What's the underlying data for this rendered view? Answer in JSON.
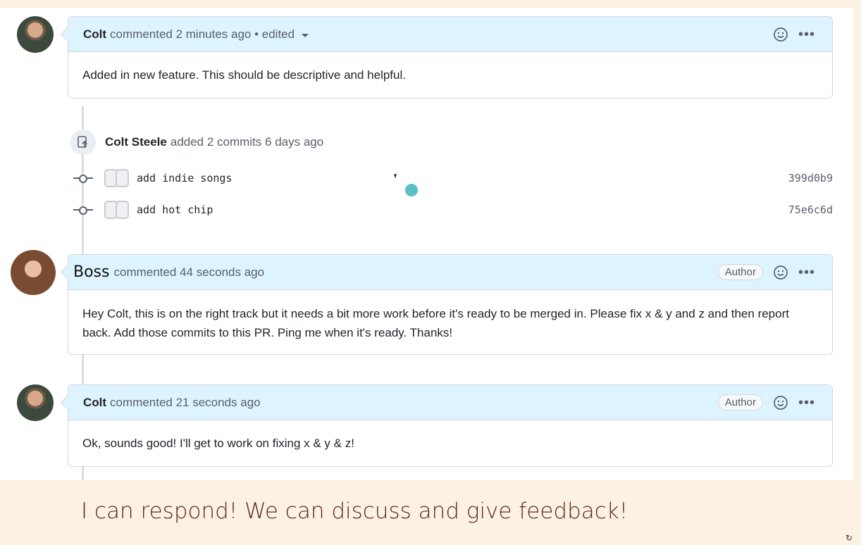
{
  "comments": [
    {
      "author": "Colt",
      "meta": "commented 2 minutes ago • edited",
      "body": "Added in new feature. This should be descriptive and helpful."
    },
    {
      "author": "Boss",
      "meta": "commented 44 seconds ago",
      "badge": "Author",
      "body": "Hey Colt, this is on the right track but it needs a bit more work before it's ready to be merged in. Please fix x & y and z and then report back. Add those commits to this PR. Ping me when it's ready. Thanks!"
    },
    {
      "author": "Colt",
      "meta": "commented 21 seconds ago",
      "badge": "Author",
      "body": "Ok, sounds good! I'll get to work on fixing x & y & z!"
    }
  ],
  "event": {
    "who": "Colt Steele",
    "text": "added 2 commits 6 days ago"
  },
  "commits": [
    {
      "message": "add indie songs",
      "sha": "399d0b9"
    },
    {
      "message": "add hot chip",
      "sha": "75e6c6d"
    }
  ],
  "caption": "I can respond! We can discuss and give feedback!",
  "colors": {
    "header_bg": "#ddf4ff",
    "border": "#d0d7de",
    "caption_text": "#5a2a1c",
    "slide_bg": "#fdf1e3"
  }
}
